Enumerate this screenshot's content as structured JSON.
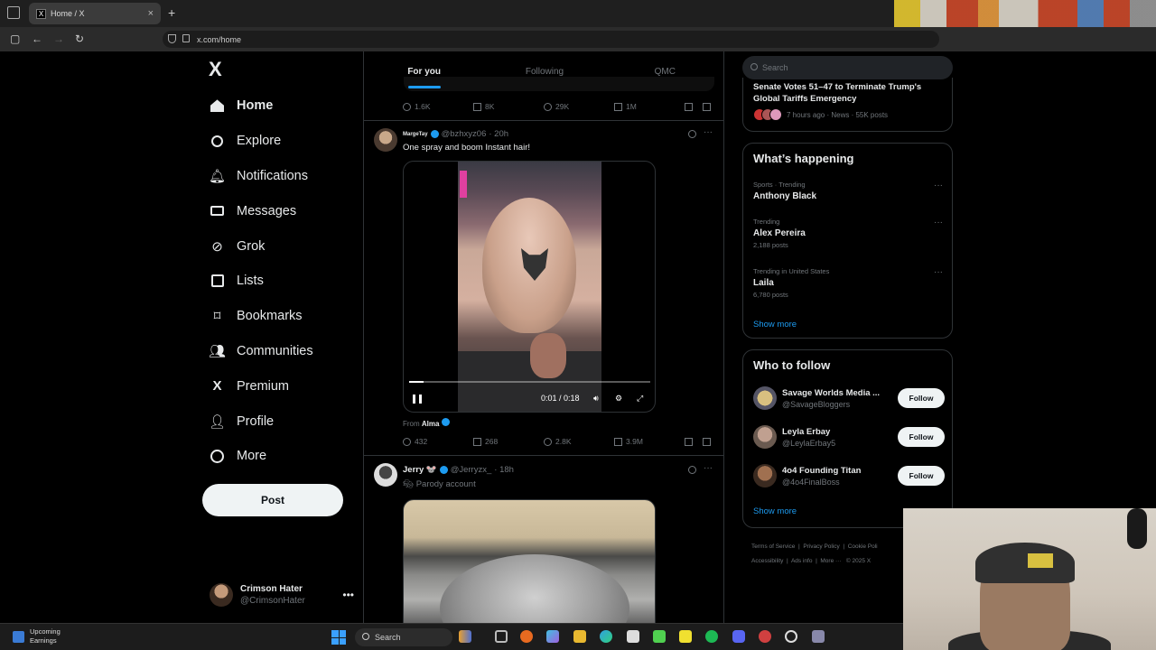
{
  "browser": {
    "tab_title": "Home / X",
    "tab_favicon": "X",
    "new_tab": "+",
    "url": "x.com/home"
  },
  "nav": {
    "logo": "X",
    "items": [
      {
        "label": "Home",
        "icon": "home-icon"
      },
      {
        "label": "Explore",
        "icon": "search-icon"
      },
      {
        "label": "Notifications",
        "icon": "bell-icon"
      },
      {
        "label": "Messages",
        "icon": "envelope-icon"
      },
      {
        "label": "Grok",
        "icon": "grok-icon"
      },
      {
        "label": "Lists",
        "icon": "list-icon"
      },
      {
        "label": "Bookmarks",
        "icon": "bookmark-icon"
      },
      {
        "label": "Communities",
        "icon": "people-icon"
      },
      {
        "label": "Premium",
        "icon": "x-icon"
      },
      {
        "label": "Profile",
        "icon": "person-icon"
      },
      {
        "label": "More",
        "icon": "more-circle-icon"
      }
    ],
    "post_button": "Post",
    "account": {
      "name": "Crimson Hater",
      "handle": "@CrimsonHater",
      "menu": "•••"
    }
  },
  "timeline": {
    "tabs": [
      "For you",
      "Following",
      "QMC"
    ],
    "prev_post_actions": {
      "replies": "1.6K",
      "reposts": "8K",
      "likes": "29K",
      "views": "1M"
    },
    "post1": {
      "author": "MargeTay",
      "handle": "@bzhxyz06",
      "time": "· 20h",
      "text": "One spray and boom Instant hair!",
      "video_time": "0:01 / 0:18",
      "video_progress": 0.06,
      "from_label": "From",
      "from_name": "Alma",
      "actions": {
        "replies": "432",
        "reposts": "268",
        "likes": "2.8K",
        "views": "3.9M"
      }
    },
    "post2": {
      "author": "Jerry 🐭",
      "handle": "@Jerryzx_",
      "time": "· 18h",
      "label": "Parody account"
    }
  },
  "right": {
    "search_placeholder": "Search",
    "top_story": {
      "headline": "Senate Votes 51–47 to Terminate Trump's Global Tariffs Emergency",
      "meta": "7 hours ago · News · 55K posts"
    },
    "happening": {
      "title": "What’s happening",
      "trends": [
        {
          "context": "Sports · Trending",
          "name": "Anthony Black",
          "count": ""
        },
        {
          "context": "Trending",
          "name": "Alex Pereira",
          "count": "2,188 posts"
        },
        {
          "context": "Trending in United States",
          "name": "Laila",
          "count": "6,780 posts"
        }
      ],
      "show_more": "Show more"
    },
    "who_to_follow": {
      "title": "Who to follow",
      "accounts": [
        {
          "name": "Savage Worlds Media ...",
          "handle": "@SavageBloggers"
        },
        {
          "name": "Leyla Erbay",
          "handle": "@LeylaErbay5"
        },
        {
          "name": "4o4 Founding Titan",
          "handle": "@4o4FinalBoss"
        }
      ],
      "follow_label": "Follow",
      "show_more": "Show more"
    },
    "footer": [
      "Terms of Service",
      "Privacy Policy",
      "Cookie Poli",
      "Accessibility",
      "Ads info",
      "More ···",
      "© 2025 X"
    ]
  },
  "taskbar": {
    "weather_title": "Upcoming",
    "weather_sub": "Earnings",
    "search": "Search"
  },
  "colors": {
    "accent": "#1d9bf0",
    "background": "#000000",
    "border": "#2f3336",
    "muted": "#71767b"
  }
}
